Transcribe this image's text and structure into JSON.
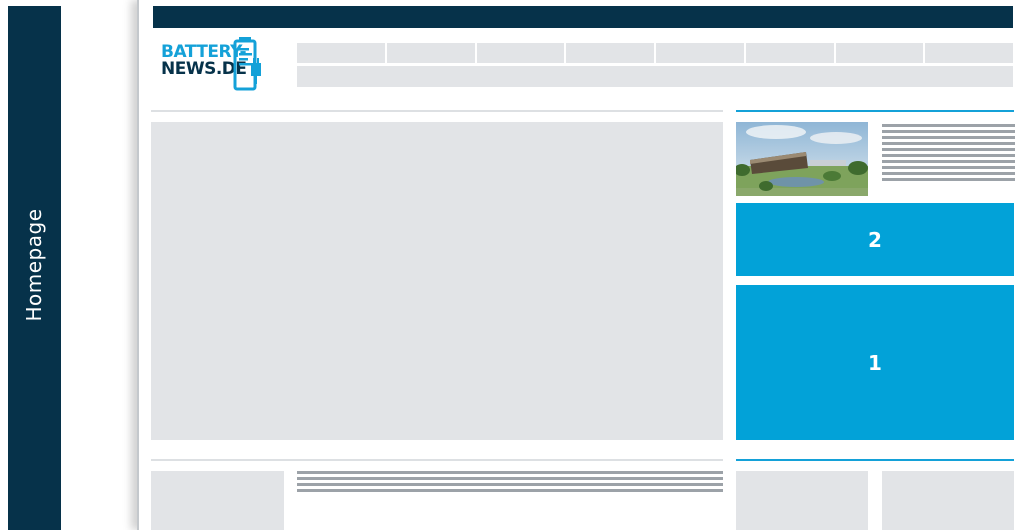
{
  "side_label": "Homepage",
  "logo": {
    "line1": "BATTERY-",
    "line2": "NEWS.DE"
  },
  "nav_cell_count": 8,
  "ad_positions": [
    {
      "label": "2"
    },
    {
      "label": "1"
    }
  ],
  "colors": {
    "navy": "#06324a",
    "accent_blue": "#02a2d8",
    "logo_blue": "#14a1d8",
    "placeholder_grey": "#e2e4e7",
    "text_line_grey": "#9ca2a8"
  }
}
